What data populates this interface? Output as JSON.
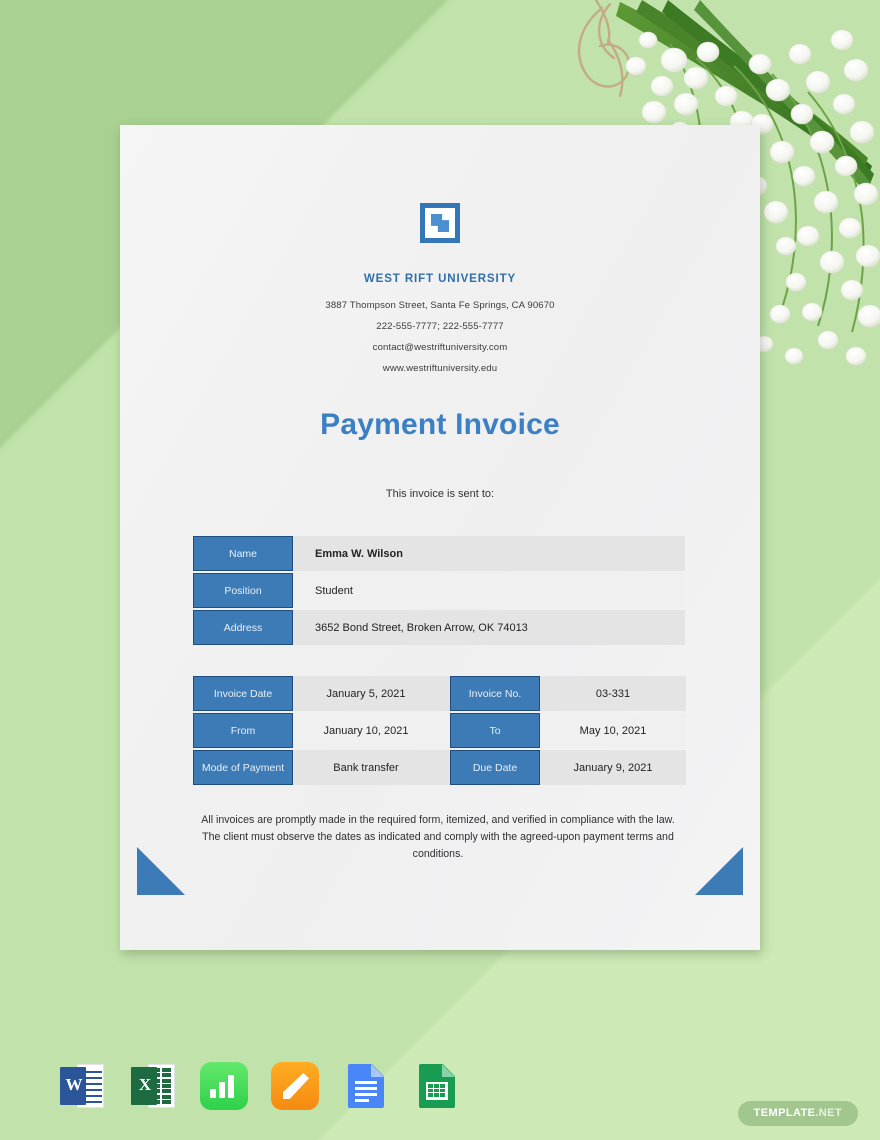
{
  "background": {
    "base_color": "#c1e3ab",
    "wedge_dark_color": "#a9d191",
    "wedge_light_color": "#cdeab6",
    "decoration": "lily-of-the-valley-bouquet-photo"
  },
  "document": {
    "logo_icon": "square-bracket-logo-icon",
    "organization": "WEST RIFT UNIVERSITY",
    "contact": [
      "3887 Thompson Street, Santa Fe Springs, CA 90670",
      "222-555-7777; 222-555-7777",
      "contact@westriftuniversity.com",
      "www.westriftuniversity.edu"
    ],
    "title": "Payment Invoice",
    "sent_to_label": "This invoice is sent to:",
    "client_table": {
      "rows": [
        {
          "label": "Name",
          "value": "Emma W. Wilson"
        },
        {
          "label": "Position",
          "value": "Student"
        },
        {
          "label": "Address",
          "value": "3652 Bond Street, Broken Arrow, OK 74013"
        }
      ]
    },
    "invoice_table": {
      "rows": [
        {
          "label_a": "Invoice Date",
          "value_a": "January 5, 2021",
          "label_b": "Invoice No.",
          "value_b": "03-331"
        },
        {
          "label_a": "From",
          "value_a": "January 10, 2021",
          "label_b": "To",
          "value_b": "May 10, 2021"
        },
        {
          "label_a": "Mode of Payment",
          "value_a": "Bank transfer",
          "label_b": "Due Date",
          "value_b": "January 9, 2021"
        }
      ]
    },
    "footnote": "All invoices are promptly made in the required form, itemized, and verified in compliance with the law. The client must observe the dates as indicated and comply with the agreed-upon payment terms and conditions.",
    "accent_color": "#3d7bb6",
    "title_color": "#3b7fc4",
    "heading_color": "#2f6fad"
  },
  "app_icons": [
    {
      "name": "microsoft-word-icon",
      "letter": "W"
    },
    {
      "name": "microsoft-excel-icon",
      "letter": "X"
    },
    {
      "name": "apple-numbers-icon",
      "letter": ""
    },
    {
      "name": "apple-pages-icon",
      "letter": ""
    },
    {
      "name": "google-docs-icon",
      "letter": ""
    },
    {
      "name": "google-sheets-icon",
      "letter": ""
    }
  ],
  "watermark": {
    "brand": "TEMPLATE",
    "suffix": ".NET"
  }
}
